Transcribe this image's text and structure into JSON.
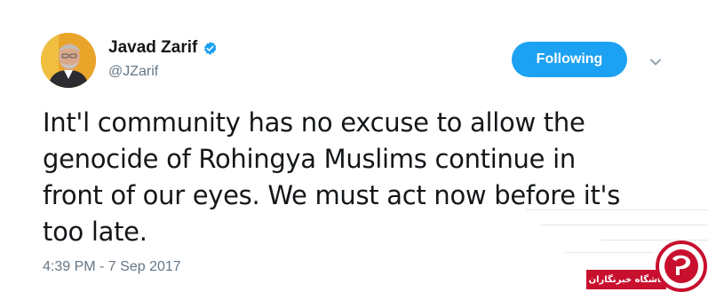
{
  "user": {
    "name": "Javad Zarif",
    "handle": "@JZarif",
    "verified": true,
    "avatar_icon": "profile-photo"
  },
  "follow_button": {
    "label": "Following",
    "color": "#1da1f2"
  },
  "menu_icon": "chevron-down-icon",
  "tweet": {
    "lines": [
      "Int'l community has no excuse to allow the",
      "genocide of Rohingya Muslims continue in",
      "front of our eyes. We must act now before it's",
      "too late."
    ]
  },
  "timestamp": "4:39 PM - 7 Sep 2017",
  "watermark": {
    "text": "باشگاه خبرنگاران",
    "color": "#c8102e"
  }
}
